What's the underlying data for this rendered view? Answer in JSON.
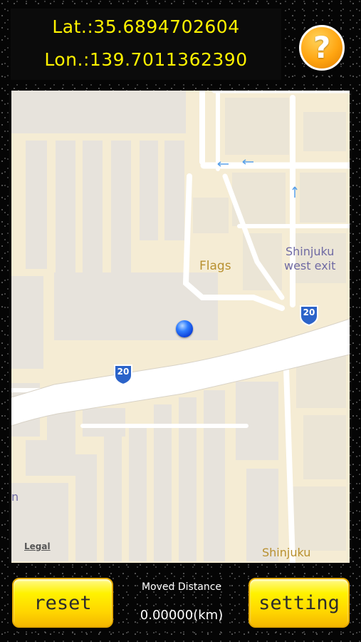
{
  "coords": {
    "lat_text": "Lat.:35.6894702604",
    "lon_text": "Lon.:139.7011362390"
  },
  "help_button": {
    "label": "?",
    "icon": "help-icon"
  },
  "map": {
    "labels": {
      "flags": "Flags",
      "shinjuku_west_exit_line1": "Shinjuku",
      "shinjuku_west_exit_line2": "west exit",
      "shinjuku": "Shinjuku",
      "edge_letter": "n"
    },
    "legal": "Legal",
    "route_shields": [
      "20",
      "20"
    ]
  },
  "footer": {
    "reset_label": "reset",
    "setting_label": "setting",
    "distance_label": "Moved Distance",
    "distance_value": "0.00000(km)"
  },
  "colors": {
    "coordinate_text": "#fff200",
    "button_yellow": "#fff200",
    "help_orange": "#ffa511",
    "map_background": "#f5ecd4",
    "location_pin": "#2f7dff"
  }
}
